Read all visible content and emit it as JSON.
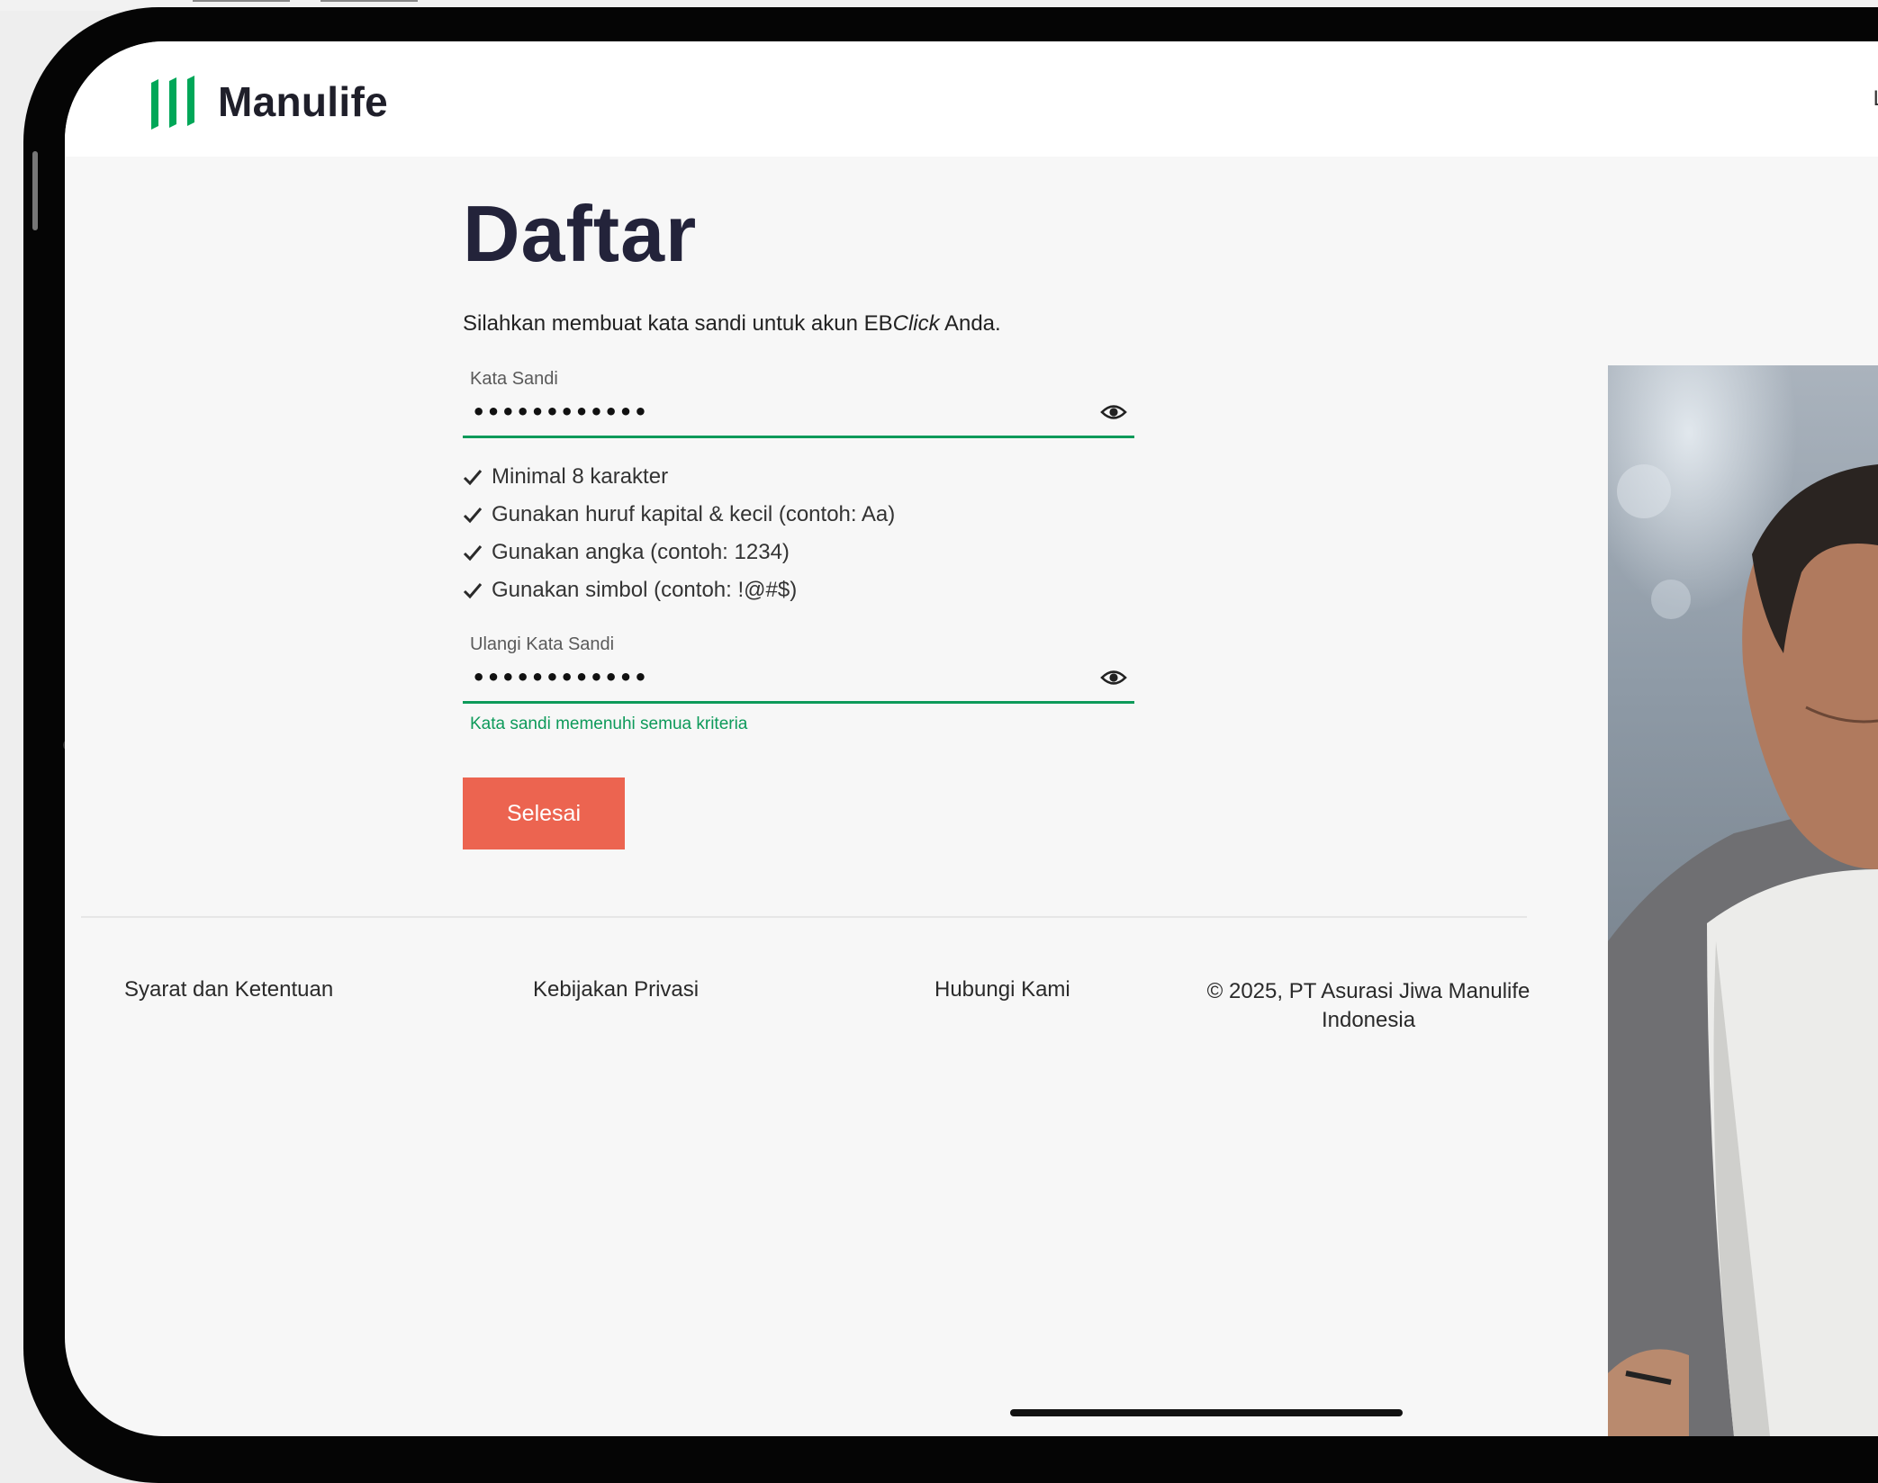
{
  "brand": {
    "name": "Manulife",
    "accent": "#00a758"
  },
  "header": {
    "right_text": "L"
  },
  "page": {
    "title": "Daftar",
    "subtitle_pre": "Silahkan membuat kata sandi untuk akun EB",
    "subtitle_em": "Click",
    "subtitle_post": " Anda."
  },
  "password": {
    "label": "Kata Sandi",
    "value": "••••••••••••",
    "icon": "eye-icon"
  },
  "rules": [
    "Minimal 8 karakter",
    "Gunakan huruf kapital & kecil (contoh: Aa)",
    "Gunakan angka (contoh: 1234)",
    "Gunakan simbol (contoh: !@#$)"
  ],
  "confirm": {
    "label": "Ulangi Kata Sandi",
    "value": "••••••••••••",
    "icon": "eye-icon",
    "success_text": "Kata sandi memenuhi semua kriteria"
  },
  "submit": {
    "label": "Selesai",
    "color": "#ec6450"
  },
  "footer": {
    "terms": "Syarat dan Ketentuan",
    "privacy": "Kebijakan Privasi",
    "contact": "Hubungi Kami",
    "copyright_line1": "© 2025, PT Asurasi Jiwa Manulife",
    "copyright_line2": "Indonesia"
  },
  "colors": {
    "success": "#0d9a5a",
    "title": "#23233a",
    "background": "#f7f7f7"
  }
}
